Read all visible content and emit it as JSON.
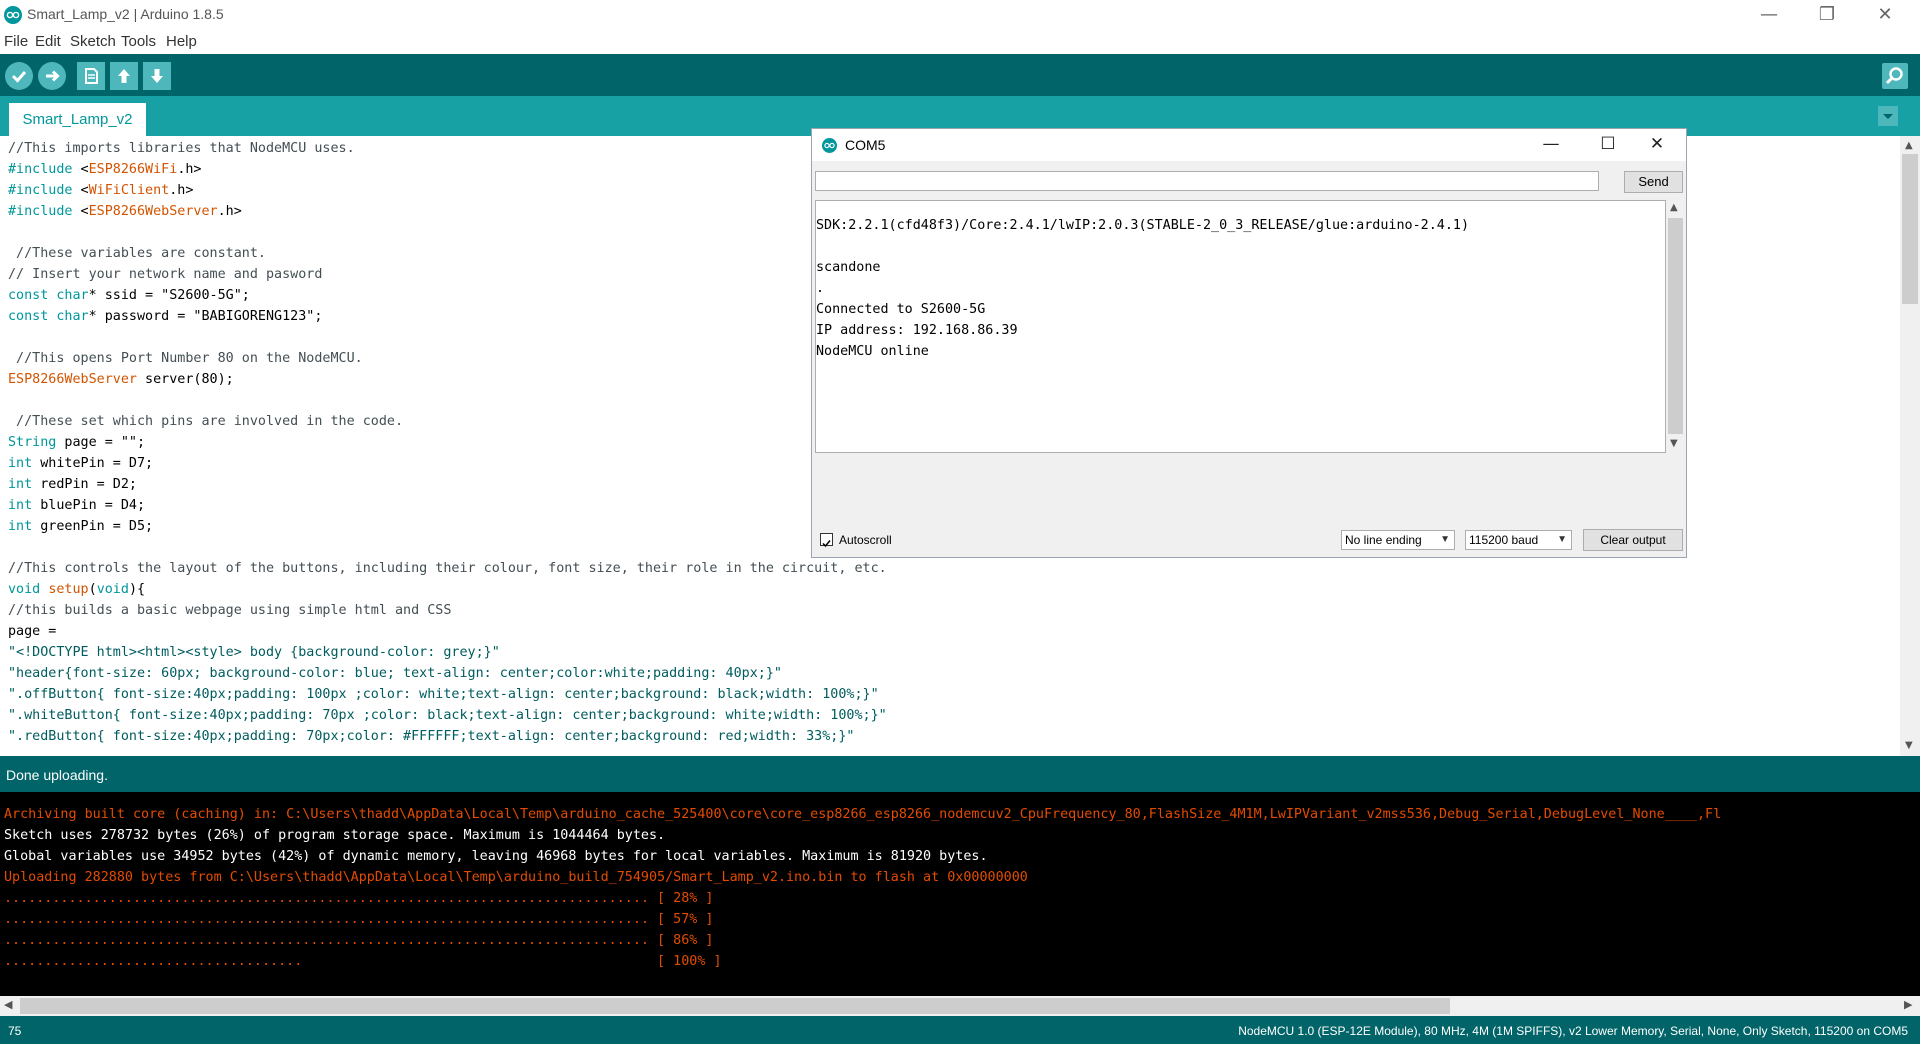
{
  "window": {
    "title": "Smart_Lamp_v2 | Arduino 1.8.5",
    "minimize_glyph": "—",
    "restore_glyph": "❐",
    "close_glyph": "✕"
  },
  "menu": {
    "items": [
      "File",
      "Edit",
      "Sketch",
      "Tools",
      "Help"
    ]
  },
  "toolbar": {
    "buttons": [
      "verify-icon",
      "upload-icon",
      "new-icon",
      "open-icon",
      "save-icon"
    ],
    "serial_monitor": "serial-monitor-icon"
  },
  "tabs": {
    "sketch_tab": "Smart_Lamp_v2"
  },
  "editor": {
    "lines": [
      "//This imports libraries that NodeMCU uses.",
      "#include <ESP8266WiFi.h>",
      "#include <WiFiClient.h>",
      "#include <ESP8266WebServer.h>",
      "",
      " //These variables are constant.",
      "// Insert your network name and pasword",
      "const char* ssid = \"S2600-5G\";",
      "const char* password = \"BABIGORENG123\";",
      "",
      " //This opens Port Number 80 on the NodeMCU.",
      "ESP8266WebServer server(80);",
      "",
      " //These set which pins are involved in the code.",
      "String page = \"\";",
      "int whitePin = D7;",
      "int redPin = D2;",
      "int bluePin = D4;",
      "int greenPin = D5;",
      "",
      "//This controls the layout of the buttons, including their colour, font size, their role in the circuit, etc.",
      "void setup(void){",
      "//this builds a basic webpage using simple html and CSS",
      "page =",
      "\"<!DOCTYPE html><html><style> body {background-color: grey;}\"",
      "\"header{font-size: 60px; background-color: blue; text-align: center;color:white;padding: 40px;}\"",
      "\".offButton{ font-size:40px;padding: 100px ;color: white;text-align: center;background: black;width: 100%;}\"",
      "\".whiteButton{ font-size:40px;padding: 70px ;color: black;text-align: center;background: white;width: 100%;}\"",
      "\".redButton{ font-size:40px;padding: 70px;color: #FFFFFF;text-align: center;background: red;width: 33%;}\""
    ]
  },
  "status": {
    "message": "Done uploading."
  },
  "console": {
    "lines": [
      "Archiving built core (caching) in: C:\\Users\\thadd\\AppData\\Local\\Temp\\arduino_cache_525400\\core\\core_esp8266_esp8266_nodemcuv2_CpuFrequency_80,FlashSize_4M1M,LwIPVariant_v2mss536,Debug_Serial,DebugLevel_None____,Fl",
      "Sketch uses 278732 bytes (26%) of program storage space. Maximum is 1044464 bytes.",
      "Global variables use 34952 bytes (42%) of dynamic memory, leaving 46968 bytes for local variables. Maximum is 81920 bytes.",
      "Uploading 282880 bytes from C:\\Users\\thadd\\AppData\\Local\\Temp\\arduino_build_754905/Smart_Lamp_v2.ino.bin to flash at 0x00000000",
      "................................................................................ [ 28% ]",
      "................................................................................ [ 57% ]",
      "................................................................................ [ 86% ]",
      ".....................................                                            [ 100% ]"
    ]
  },
  "bottom_bar": {
    "line_number": "75",
    "board_info": "NodeMCU 1.0 (ESP-12E Module), 80 MHz, 4M (1M SPIFFS), v2 Lower Memory, Serial, None, Only Sketch, 115200 on COM5"
  },
  "serial_monitor": {
    "title": "COM5",
    "input_value": "",
    "send_label": "Send",
    "output_lines": [
      "",
      "SDK:2.2.1(cfd48f3)/Core:2.4.1/lwIP:2.0.3(STABLE-2_0_3_RELEASE/glue:arduino-2.4.1)",
      "",
      "scandone",
      ".",
      "Connected to S2600-5G",
      "IP address: 192.168.86.39",
      "NodeMCU online"
    ],
    "autoscroll_label": "Autoscroll",
    "autoscroll_checked": true,
    "line_ending": "No line ending",
    "baud": "115200 baud",
    "clear_label": "Clear output"
  },
  "colors": {
    "teal_dark": "#006468",
    "teal_mid": "#17a1a5",
    "teal_light": "#4db7bb",
    "console_orange": "#e34c00"
  }
}
